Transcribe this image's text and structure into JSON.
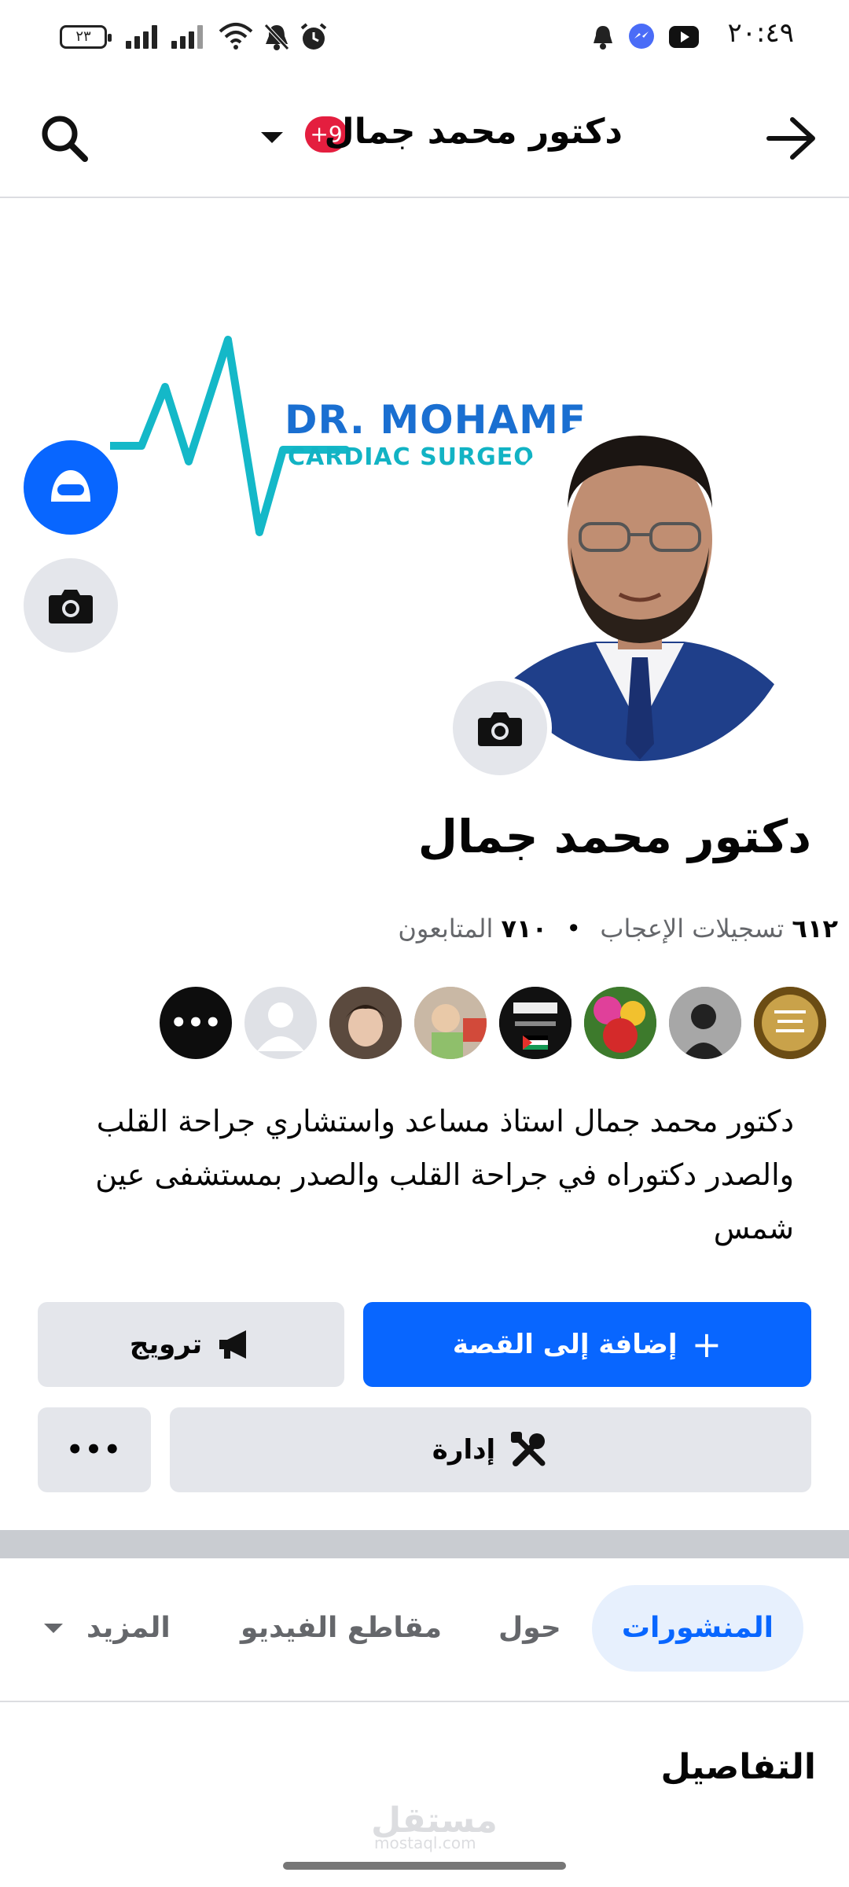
{
  "status_bar": {
    "time": "٢٠:٤٩",
    "battery_level": "٢٣",
    "icons": [
      "signal-icon",
      "wifi-icon",
      "bell-off-icon",
      "alarm-icon",
      "notification-bell-icon",
      "messenger-icon",
      "youtube-icon"
    ]
  },
  "header": {
    "title": "دكتور محمد جمال",
    "notification_badge": "+9",
    "back_icon": "arrow-right-icon",
    "search_icon": "search-icon",
    "dropdown_icon": "caret-down-icon"
  },
  "cover": {
    "brand_line1": "DR. MOHAME",
    "brand_line2": "CARDIAC SURGEO",
    "accent_blue": "#1a6fd1",
    "accent_teal": "#12b3c4"
  },
  "profile": {
    "name": "دكتور محمد جمال",
    "likes_count": "٦١٢",
    "likes_label": "تسجيلات الإعجاب",
    "followers_count": "٧١٠",
    "followers_label": "المتابعون",
    "bio": "دكتور محمد جمال استاذ مساعد واستشاري جراحة القلب والصدر دكتوراه في جراحة القلب والصدر بمستشفى عين شمس"
  },
  "friend_avatars": {
    "more_label": "•••"
  },
  "actions": {
    "add_story": "إضافة إلى القصة",
    "promote": "ترويج",
    "manage": "إدارة",
    "more": "•••"
  },
  "tabs": {
    "posts": "المنشورات",
    "about": "حول",
    "videos": "مقاطع الفيديو",
    "more": "المزيد"
  },
  "details": {
    "heading": "التفاصيل"
  },
  "watermark": {
    "text": "مستقل",
    "domain": "mostaql.com"
  },
  "colors": {
    "primary": "#0866ff",
    "badge": "#e41e3f",
    "gray_button": "#e4e6eb"
  }
}
